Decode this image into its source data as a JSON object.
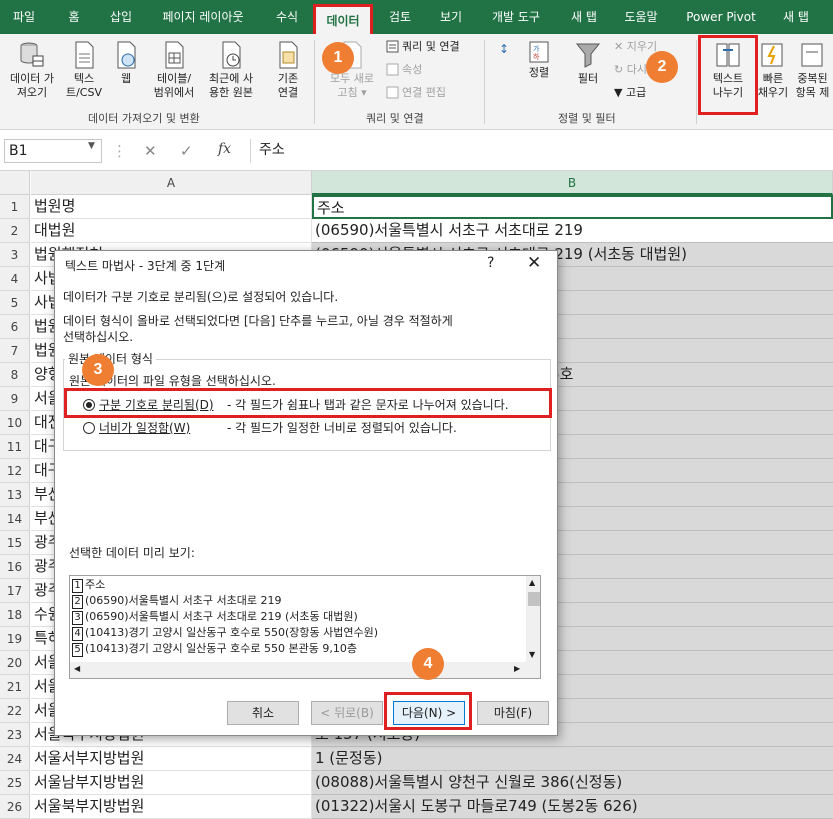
{
  "tabs": [
    "파일",
    "홈",
    "삽입",
    "페이지 레이아웃",
    "수식",
    "데이터",
    "검토",
    "보기",
    "개발 도구",
    "새 탭",
    "도움말",
    "Power Pivot",
    "새 탭"
  ],
  "ribbon": {
    "get_data": [
      "데이터 가",
      "져오기"
    ],
    "text_csv": [
      "텍스",
      "트/CSV"
    ],
    "web": "웹",
    "table_range": [
      "테이블/",
      "범위에서"
    ],
    "recent": [
      "최근에 사",
      "용한 원본"
    ],
    "existing": [
      "기존",
      "연결"
    ],
    "refresh_all": [
      "모두 새로",
      "고침"
    ],
    "queries_conn": "쿼리 및 연결",
    "properties": "속성",
    "edit_links": "연결 편집",
    "sort": "정렬",
    "filter": "필터",
    "clear": "지우기",
    "reapply": "다시",
    "advanced": "고급",
    "text_to_cols": [
      "텍스트",
      "나누기"
    ],
    "flash_fill": [
      "빠른",
      "채우기"
    ],
    "remove_dup": [
      "중복된",
      "항목 제"
    ],
    "group_get": "데이터 가져오기 및 변환",
    "group_query": "쿼리 및 연결",
    "group_sort": "정렬 및 필터"
  },
  "formula_bar": {
    "name_box": "B1",
    "fx": "fx",
    "value": "주소"
  },
  "columns": [
    "A",
    "B"
  ],
  "rows": [
    {
      "n": "1",
      "a": "법원명",
      "b": "주소"
    },
    {
      "n": "2",
      "a": "대법원",
      "b": "(06590)서울특별시 서초구 서초대로 219"
    },
    {
      "n": "3",
      "a": "법원행정처",
      "b": "(06590)서울특별시 서초구 서초대로 219 (서초동 대법원)"
    },
    {
      "n": "4",
      "a": "사법연수원",
      "b": "550(장항동 사법연수원)"
    },
    {
      "n": "5",
      "a": "사법정책연구원",
      "b": "550 본관동 9,10층"
    },
    {
      "n": "6",
      "a": "법원공무원교육원",
      "b": "523(장항동)"
    },
    {
      "n": "7",
      "a": "법원도서관",
      "b": "로 550"
    },
    {
      "n": "8",
      "a": "양형위원회",
      "b": "219 (서초동 대법원) 대법원 동관 235호"
    },
    {
      "n": "9",
      "a": "서울고등법원",
      "b": "로 157"
    },
    {
      "n": "10",
      "a": "대전고등법원",
      "b": "번길 45(둔산동)"
    },
    {
      "n": "11",
      "a": "대구고등법원",
      "b": "로62번길 51 (산남동 505)"
    },
    {
      "n": "12",
      "a": "대구고등법원",
      "b": "364"
    },
    {
      "n": "13",
      "a": "부산고등법원",
      "b": "(거제동 1500번지)"
    },
    {
      "n": "14",
      "a": "부산고등법원",
      "b": "대로 681 (사파동 1번지)"
    },
    {
      "n": "15",
      "a": "광주고등법원",
      "b": "2(지산2동 342-1"
    },
    {
      "n": "16",
      "a": "광주고등법원",
      "b": "로 33 (만성동) 전주지방법원"
    },
    {
      "n": "17",
      "a": "광주고등법원",
      "b": "북 5길 3(이도이동)"
    },
    {
      "n": "18",
      "a": "수원고등법원",
      "b": "105"
    },
    {
      "n": "19",
      "a": "특허법원",
      "b": "(둔산동)"
    },
    {
      "n": "20",
      "a": "서울중앙지방법원",
      "b": "로 157 (서초동)"
    },
    {
      "n": "21",
      "a": "서울동부지방법원",
      "b": "재동 25-3)"
    },
    {
      "n": "22",
      "a": "서울남부지방법원",
      "b": "재동 25-3)"
    },
    {
      "n": "23",
      "a": "서울북부지방법원",
      "b": "로 157 (서초동)"
    },
    {
      "n": "24",
      "a": "서울서부지방법원",
      "b": "1 (문정동)"
    },
    {
      "n": "25",
      "a": "서울남부지방법원",
      "b": "(08088)서울특별시 양천구 신월로 386(신정동)"
    },
    {
      "n": "26",
      "a": "서울북부지방법원",
      "b": "(01322)서울시 도봉구 마들로749 (도봉2동 626)"
    }
  ],
  "dialog": {
    "title": "텍스트 마법사 - 3단계 중 1단계",
    "help": "?",
    "close": "✕",
    "line1": "데이터가 구분 기호로 분리됨(으)로 설정되어 있습니다.",
    "line2": "데이터 형식이 올바로 선택되었다면 [다음] 단추를 누르고, 아닐 경우 적절하게",
    "line3": "선택하십시오.",
    "group_title": "원본 데이터 형식",
    "choose": "원본 데이터의 파일 유형을 선택하십시오.",
    "opt1_label": "구분 기호로 분리됨(D)",
    "opt1_desc": "- 각 필드가 쉼표나 탭과 같은 문자로 나누어져 있습니다.",
    "opt2_label": "너비가 일정함(W)",
    "opt2_desc": "- 각 필드가 일정한 너비로 정렬되어 있습니다.",
    "preview_label": "선택한 데이터 미리 보기:",
    "preview": [
      {
        "n": "1",
        "t": "주소"
      },
      {
        "n": "2",
        "t": "(06590)서울특별시 서초구 서초대로 219"
      },
      {
        "n": "3",
        "t": "(06590)서울특별시 서초구 서초대로 219 (서초동 대법원)"
      },
      {
        "n": "4",
        "t": "(10413)경기 고양시 일산동구 호수로 550(장항동 사법연수원)"
      },
      {
        "n": "5",
        "t": "(10413)경기 고양시 일산동구 호수로 550 본관동 9,10층"
      }
    ],
    "btn_cancel": "취소",
    "btn_back": "< 뒤로(B)",
    "btn_next": "다음(N) >",
    "btn_finish": "마침(F)"
  },
  "badges": [
    "1",
    "2",
    "3",
    "4"
  ],
  "colors": {
    "excel_green": "#217346",
    "highlight_red": "#e02020",
    "badge_orange": "#ef7d32"
  }
}
